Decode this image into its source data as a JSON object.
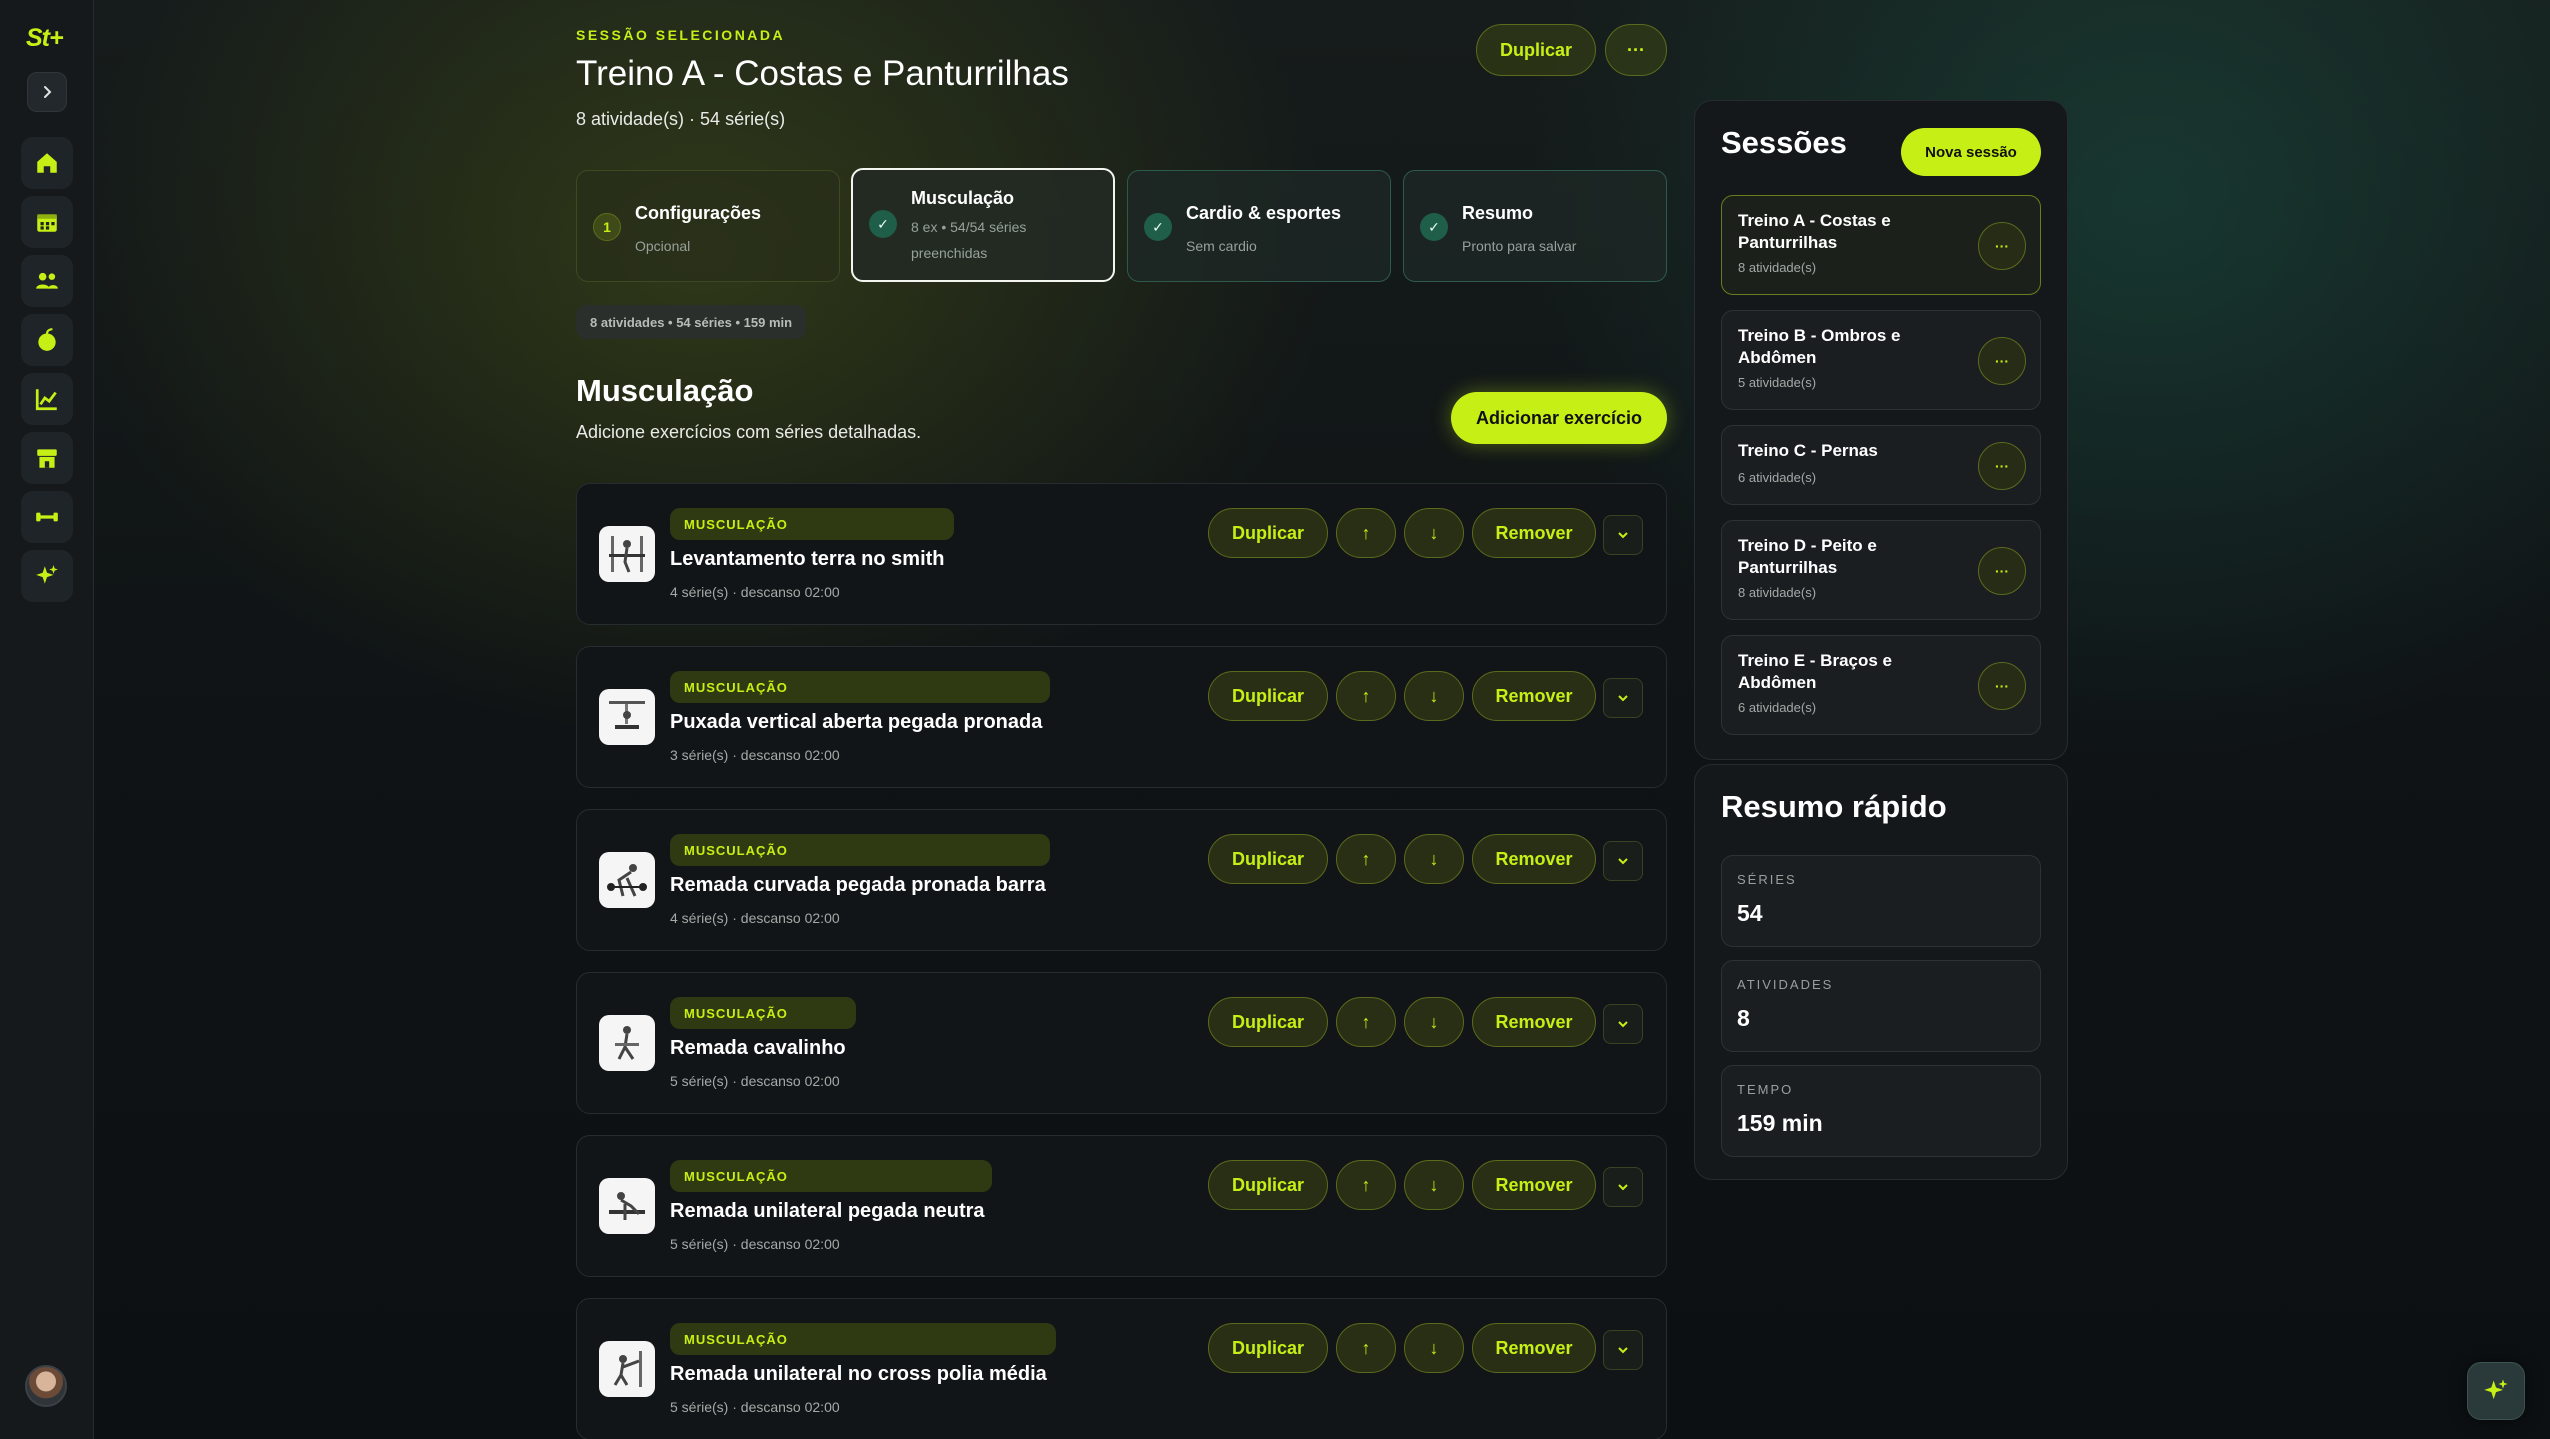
{
  "sidebar": {
    "logo": "St+",
    "items": [
      {
        "icon": "home-icon"
      },
      {
        "icon": "calendar-icon"
      },
      {
        "icon": "users-icon"
      },
      {
        "icon": "apple-icon"
      },
      {
        "icon": "chart-icon"
      },
      {
        "icon": "store-icon"
      },
      {
        "icon": "dumbbell-icon"
      },
      {
        "icon": "sparkles-icon"
      }
    ]
  },
  "header": {
    "eyebrow": "SESSÃO SELECIONADA",
    "title": "Treino A - Costas e Panturrilhas",
    "subtitle": "8 atividade(s) · 54 série(s)",
    "duplicate_label": "Duplicar",
    "more_label": "···"
  },
  "steps": [
    {
      "marker": "1",
      "title": "Configurações",
      "desc": "Opcional"
    },
    {
      "marker": "✓",
      "title": "Musculação",
      "desc": "8 ex • 54/54 séries preenchidas"
    },
    {
      "marker": "✓",
      "title": "Cardio & esportes",
      "desc": "Sem cardio"
    },
    {
      "marker": "✓",
      "title": "Resumo",
      "desc": "Pronto para salvar"
    }
  ],
  "summary_pill": "8 atividades • 54 séries • 159 min",
  "section": {
    "title": "Musculação",
    "subtitle": "Adicione exercícios com séries detalhadas.",
    "add_label": "Adicionar exercício"
  },
  "exercise_actions": {
    "duplicate": "Duplicar",
    "remove": "Remover",
    "up": "↑",
    "down": "↓"
  },
  "exercises": [
    {
      "tag": "MUSCULAÇÃO",
      "name": "Levantamento terra no smith",
      "meta": "4 série(s) · descanso 02:00"
    },
    {
      "tag": "MUSCULAÇÃO",
      "name": "Puxada vertical aberta pegada pronada",
      "meta": "3 série(s) · descanso 02:00"
    },
    {
      "tag": "MUSCULAÇÃO",
      "name": "Remada curvada pegada pronada barra",
      "meta": "4 série(s) · descanso 02:00"
    },
    {
      "tag": "MUSCULAÇÃO",
      "name": "Remada cavalinho",
      "meta": "5 série(s) · descanso 02:00"
    },
    {
      "tag": "MUSCULAÇÃO",
      "name": "Remada unilateral pegada neutra",
      "meta": "5 série(s) · descanso 02:00"
    },
    {
      "tag": "MUSCULAÇÃO",
      "name": "Remada unilateral no cross polia média",
      "meta": "5 série(s) · descanso 02:00"
    }
  ],
  "sessions": {
    "title": "Sessões",
    "new_label": "Nova sessão",
    "more_label": "···",
    "items": [
      {
        "name": "Treino A - Costas e Panturrilhas",
        "count": "8 atividade(s)"
      },
      {
        "name": "Treino B - Ombros e Abdômen",
        "count": "5 atividade(s)"
      },
      {
        "name": "Treino C - Pernas",
        "count": "6 atividade(s)"
      },
      {
        "name": "Treino D - Peito e Panturrilhas",
        "count": "8 atividade(s)"
      },
      {
        "name": "Treino E - Braços e Abdômen",
        "count": "6 atividade(s)"
      }
    ]
  },
  "quick_summary": {
    "title": "Resumo rápido",
    "stats": [
      {
        "label": "SÉRIES",
        "value": "54"
      },
      {
        "label": "ATIVIDADES",
        "value": "8"
      },
      {
        "label": "TEMPO",
        "value": "159 min"
      }
    ]
  },
  "colors": {
    "accent": "#c6f015",
    "background": "#0e1214",
    "panel": "#14181b",
    "step_done": "#1f5e48"
  }
}
